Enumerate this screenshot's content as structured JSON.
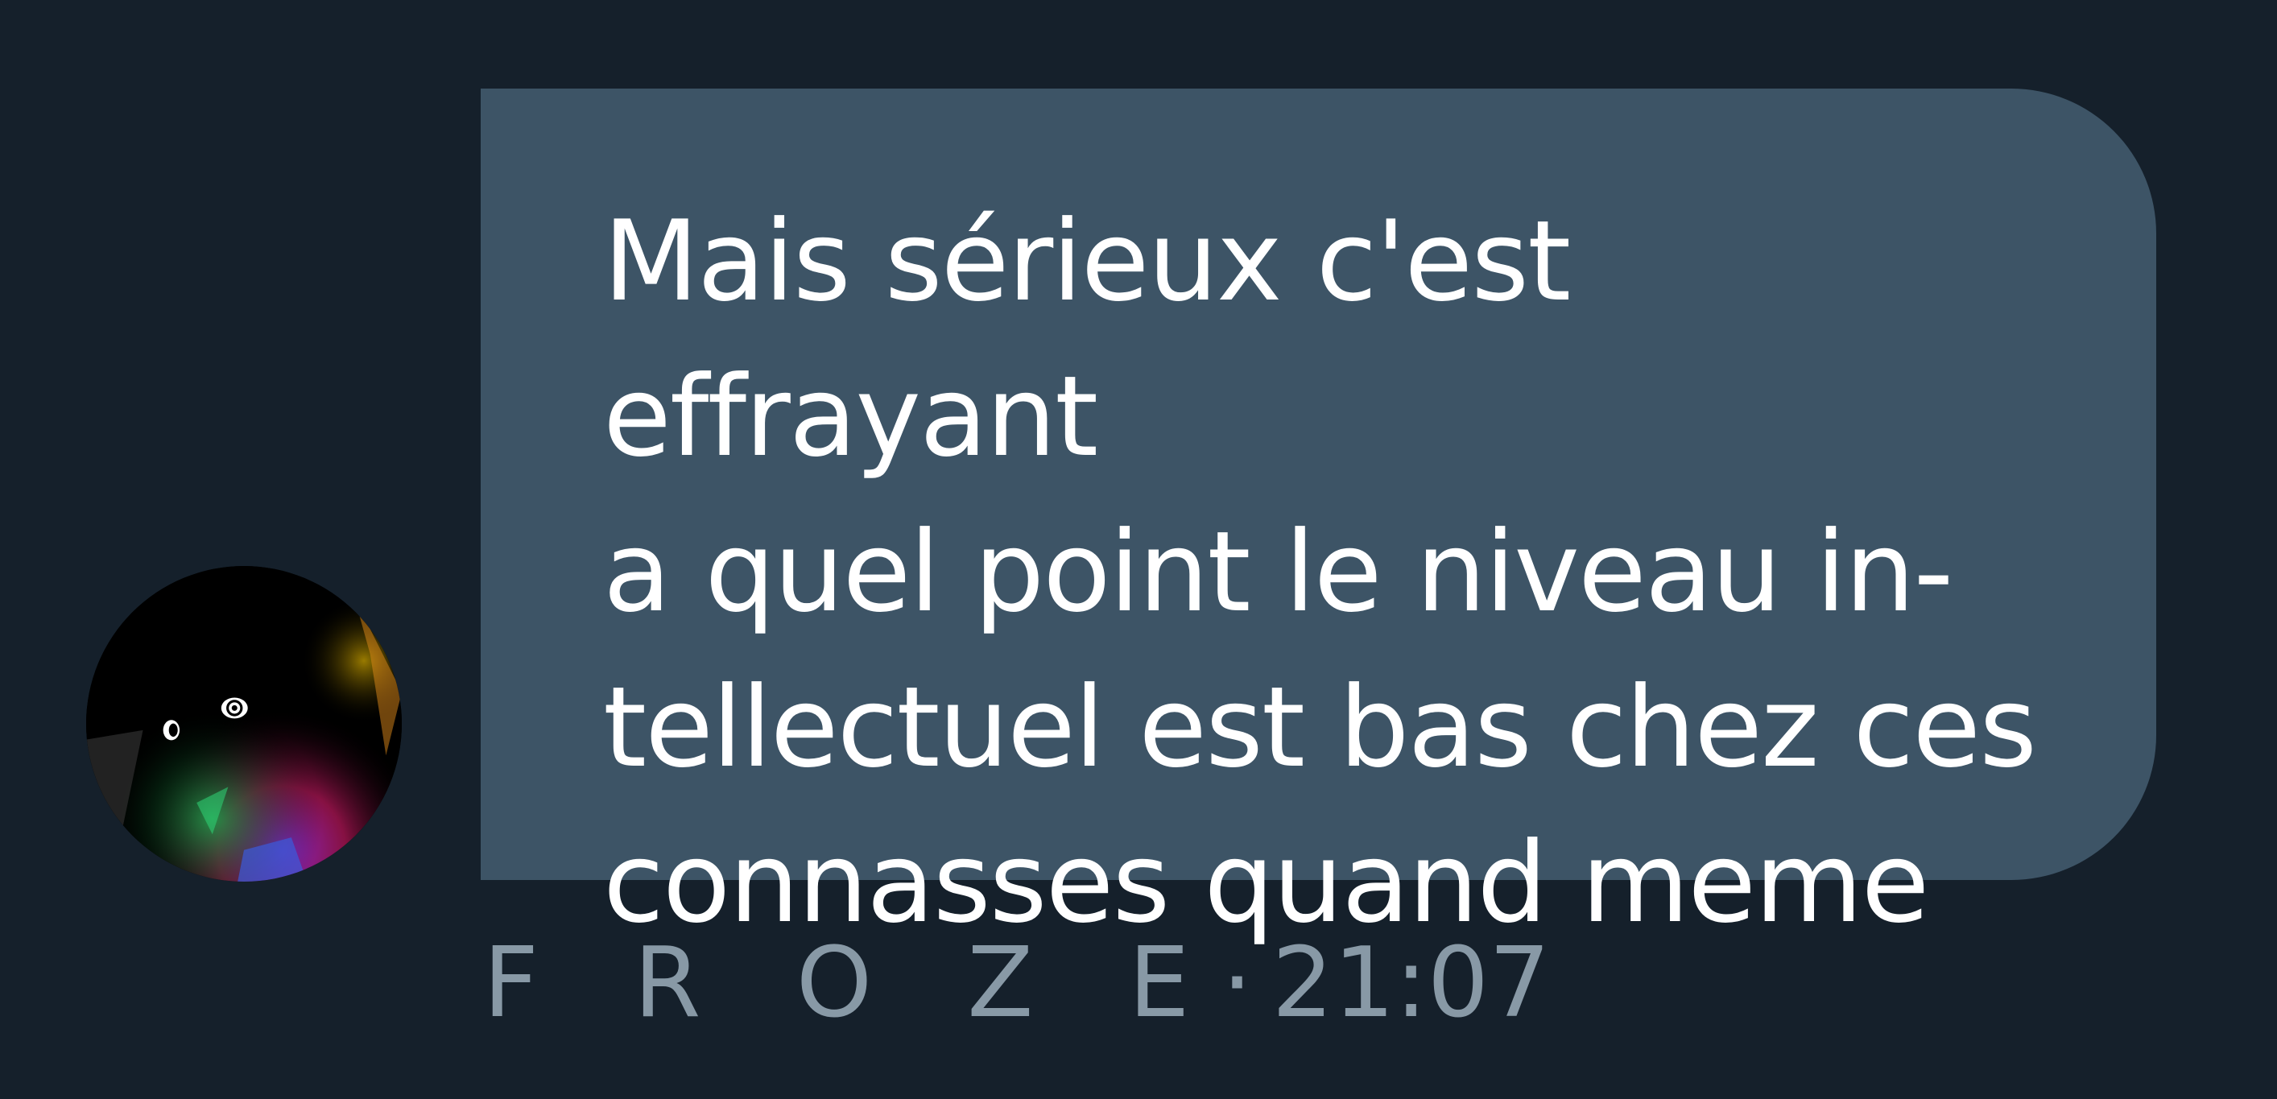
{
  "message": {
    "text_lines": [
      "Mais sérieux c'est effrayant",
      "a quel point le niveau in-",
      "tellectuel est bas chez ces",
      "connasses quand meme"
    ],
    "sender": "F R O Z E",
    "separator": "·",
    "time": "21:07"
  },
  "colors": {
    "background": "#15202b",
    "bubble": "#3d5466",
    "bubble_text": "#ffffff",
    "meta_text": "#8899a6"
  },
  "icons": {
    "avatar": "profile-picture-dark-eyes-rainbow"
  }
}
